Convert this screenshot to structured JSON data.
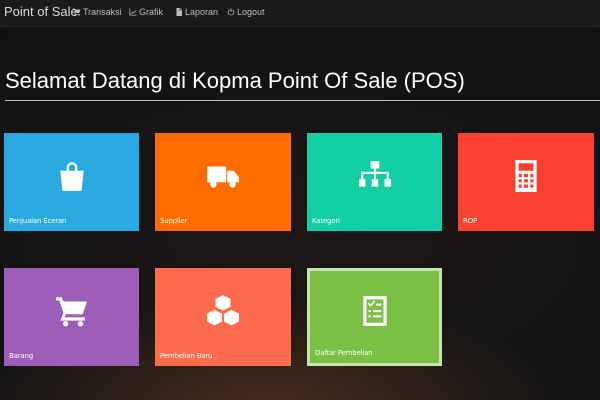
{
  "navbar": {
    "brand": "Point of Sale",
    "items": [
      {
        "icon": "cart-icon",
        "label": "Transaksi"
      },
      {
        "icon": "chart-icon",
        "label": "Grafik"
      },
      {
        "icon": "file-icon",
        "label": "Laporan"
      },
      {
        "icon": "logout-icon",
        "label": "Logout"
      }
    ]
  },
  "main": {
    "title": "Selamat Datang di Kopma Point Of Sale (POS)"
  },
  "tiles": [
    {
      "label": "Penjualan Eceran",
      "icon": "shopping-bag-icon",
      "color": "#29a9e0"
    },
    {
      "label": "Supplier",
      "icon": "truck-icon",
      "color": "#fe6b00"
    },
    {
      "label": "Kategori",
      "icon": "sitemap-icon",
      "color": "#13cfa5"
    },
    {
      "label": "ROP",
      "icon": "calculator-icon",
      "color": "#fa4130"
    },
    {
      "label": "Barang",
      "icon": "cart-icon",
      "color": "#9c5eb8"
    },
    {
      "label": "Pembelian Baru",
      "icon": "cubes-icon",
      "color": "#fc6b4e"
    },
    {
      "label": "Daftar Pembelian",
      "icon": "list-icon",
      "color": "#7bbf45"
    }
  ]
}
